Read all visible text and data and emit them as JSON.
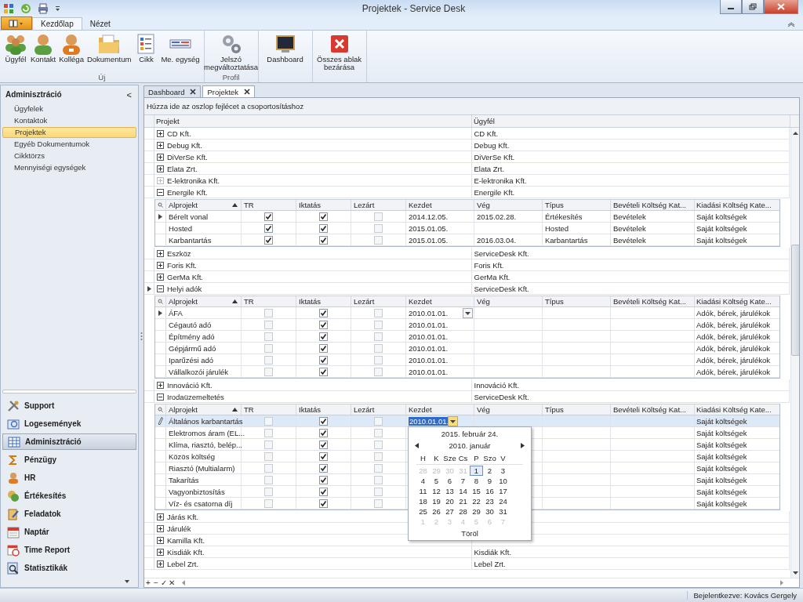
{
  "window": {
    "title": "Projektek - Service Desk"
  },
  "ribbon": {
    "tabs": [
      {
        "label": "Kezdőlap",
        "selected": true
      },
      {
        "label": "Nézet",
        "selected": false
      }
    ],
    "groups": [
      {
        "label": "Új",
        "buttons": [
          "Ügyfél",
          "Kontakt",
          "Kolléga",
          "Dokumentum",
          "Cikk",
          "Me. egység"
        ]
      },
      {
        "label": "Profil",
        "buttons": [
          "Jelszó megváltoztatása"
        ]
      },
      {
        "buttons": [
          "Dashboard"
        ]
      },
      {
        "buttons": [
          "Összes ablak bezárása"
        ]
      }
    ]
  },
  "sidebar": {
    "title": "Adminisztráció",
    "collapse": "<",
    "items": [
      {
        "label": "Ügyfelek",
        "selected": false
      },
      {
        "label": "Kontaktok",
        "selected": false
      },
      {
        "label": "Projektek",
        "selected": true
      },
      {
        "label": "Egyéb Dokumentumok",
        "selected": false
      },
      {
        "label": "Cikktörzs",
        "selected": false
      },
      {
        "label": "Mennyiségi egységek",
        "selected": false
      }
    ],
    "nav": [
      {
        "label": "Support",
        "selected": false
      },
      {
        "label": "Logesemények",
        "selected": false
      },
      {
        "label": "Adminisztráció",
        "selected": true
      },
      {
        "label": "Pénzügy",
        "selected": false
      },
      {
        "label": "HR",
        "selected": false
      },
      {
        "label": "Értékesítés",
        "selected": false
      },
      {
        "label": "Feladatok",
        "selected": false
      },
      {
        "label": "Naptár",
        "selected": false
      },
      {
        "label": "Time Report",
        "selected": false
      },
      {
        "label": "Statisztikák",
        "selected": false
      }
    ]
  },
  "doc_tabs": [
    {
      "label": "Dashboard",
      "selected": false
    },
    {
      "label": "Projektek",
      "selected": true
    }
  ],
  "grid": {
    "group_panel": "Húzza ide az oszlop fejlécet a csoportosításhoz",
    "columns": [
      "Projekt",
      "Ügyfél"
    ],
    "rows": [
      {
        "projekt": "CD Kft.",
        "ugyfel": "CD Kft.",
        "expanded": false,
        "disabled": false,
        "current": false
      },
      {
        "projekt": "Debug Kft.",
        "ugyfel": "Debug Kft.",
        "expanded": false,
        "disabled": false,
        "current": false
      },
      {
        "projekt": "DiVerSe Kft.",
        "ugyfel": "DiVerSe Kft.",
        "expanded": false,
        "disabled": false,
        "current": false
      },
      {
        "projekt": "Elata Zrt.",
        "ugyfel": "Elata Zrt.",
        "expanded": false,
        "disabled": false,
        "current": false
      },
      {
        "projekt": "E-lektronika Kft.",
        "ugyfel": "E-lektronika Kft.",
        "expanded": false,
        "disabled": true,
        "current": false
      },
      {
        "projekt": "Energile Kft.",
        "ugyfel": "Energile Kft.",
        "expanded": true,
        "disabled": false,
        "current": false,
        "subgrid": {
          "columns": [
            {
              "label": "Alprojekt",
              "sorted": true
            },
            {
              "label": "TR",
              "sorted": false
            },
            {
              "label": "Iktatás",
              "sorted": false
            },
            {
              "label": "Lezárt",
              "sorted": false
            },
            {
              "label": "Kezdet",
              "sorted": false
            },
            {
              "label": "Vég",
              "sorted": false
            },
            {
              "label": "Típus",
              "sorted": false
            },
            {
              "label": "Bevételi Költség Kat...",
              "sorted": false
            },
            {
              "label": "Kiadási Költség Kate...",
              "sorted": false
            }
          ],
          "rows": [
            {
              "current": true,
              "editing": false,
              "selected": false,
              "kezdet_dropdown": false,
              "alprojekt": "Bérelt vonal",
              "tr": true,
              "iktatas": true,
              "lezart": false,
              "kezdet": "2014.12.05.",
              "veg": "2015.02.28.",
              "tipus": "Értékesítés",
              "bevetel": "Bevételek",
              "kiadas": "Saját költségek"
            },
            {
              "current": false,
              "editing": false,
              "selected": false,
              "kezdet_dropdown": false,
              "alprojekt": "Hosted",
              "tr": true,
              "iktatas": true,
              "lezart": false,
              "kezdet": "2015.01.05.",
              "tipus": "Hosted",
              "bevetel": "Bevételek",
              "kiadas": "Saját költségek"
            },
            {
              "current": false,
              "editing": false,
              "selected": false,
              "kezdet_dropdown": false,
              "alprojekt": "Karbantartás",
              "tr": true,
              "iktatas": true,
              "lezart": false,
              "kezdet": "2015.01.05.",
              "veg": "2016.03.04.",
              "tipus": "Karbantartás",
              "bevetel": "Bevételek",
              "kiadas": "Saját költségek"
            }
          ]
        }
      },
      {
        "projekt": "Eszköz",
        "ugyfel": "ServiceDesk Kft.",
        "expanded": false,
        "disabled": false,
        "current": false
      },
      {
        "projekt": "Foris Kft.",
        "ugyfel": "Foris Kft.",
        "expanded": false,
        "disabled": false,
        "current": false
      },
      {
        "projekt": "GerMa Kft.",
        "ugyfel": "GerMa Kft.",
        "expanded": false,
        "disabled": false,
        "current": false
      },
      {
        "projekt": "Helyi adók",
        "ugyfel": "ServiceDesk Kft.",
        "expanded": true,
        "disabled": false,
        "current": true,
        "subgrid": {
          "columns": [
            {
              "label": "Alprojekt",
              "sorted": true
            },
            {
              "label": "TR",
              "sorted": false
            },
            {
              "label": "Iktatás",
              "sorted": false
            },
            {
              "label": "Lezárt",
              "sorted": false
            },
            {
              "label": "Kezdet",
              "sorted": false
            },
            {
              "label": "Vég",
              "sorted": false
            },
            {
              "label": "Típus",
              "sorted": false
            },
            {
              "label": "Bevételi Költség Kat...",
              "sorted": false
            },
            {
              "label": "Kiadási Költség Kate...",
              "sorted": false
            }
          ],
          "rows": [
            {
              "current": true,
              "editing": false,
              "selected": false,
              "kezdet_dropdown": true,
              "alprojekt": "ÁFA",
              "tr": false,
              "iktatas": true,
              "lezart": false,
              "kezdet": "2010.01.01.",
              "kiadas": "Adók, bérek, járulékok"
            },
            {
              "current": false,
              "editing": false,
              "selected": false,
              "kezdet_dropdown": false,
              "alprojekt": "Cégautó adó",
              "tr": false,
              "iktatas": true,
              "lezart": false,
              "kezdet": "2010.01.01.",
              "kiadas": "Adók, bérek, járulékok"
            },
            {
              "current": false,
              "editing": false,
              "selected": false,
              "kezdet_dropdown": false,
              "alprojekt": "Építmény adó",
              "tr": false,
              "iktatas": true,
              "lezart": false,
              "kezdet": "2010.01.01.",
              "kiadas": "Adók, bérek, járulékok"
            },
            {
              "current": false,
              "editing": false,
              "selected": false,
              "kezdet_dropdown": false,
              "alprojekt": "Gépjármű adó",
              "tr": false,
              "iktatas": true,
              "lezart": false,
              "kezdet": "2010.01.01.",
              "kiadas": "Adók, bérek, járulékok"
            },
            {
              "current": false,
              "editing": false,
              "selected": false,
              "kezdet_dropdown": false,
              "alprojekt": "Iparűzési adó",
              "tr": false,
              "iktatas": true,
              "lezart": false,
              "kezdet": "2010.01.01.",
              "kiadas": "Adók, bérek, járulékok"
            },
            {
              "current": false,
              "editing": false,
              "selected": false,
              "kezdet_dropdown": false,
              "alprojekt": "Vállalkozói járulék",
              "tr": false,
              "iktatas": true,
              "lezart": false,
              "kezdet": "2010.01.01.",
              "kiadas": "Adók, bérek, járulékok"
            }
          ]
        }
      },
      {
        "projekt": "Innováció Kft.",
        "ugyfel": "Innováció Kft.",
        "expanded": false,
        "disabled": false,
        "current": false
      },
      {
        "projekt": "Irodaüzemeltetés",
        "ugyfel": "ServiceDesk Kft.",
        "expanded": true,
        "disabled": false,
        "current": false,
        "subgrid": {
          "columns": [
            {
              "label": "Alprojekt",
              "sorted": true
            },
            {
              "label": "TR",
              "sorted": false
            },
            {
              "label": "Iktatás",
              "sorted": false
            },
            {
              "label": "Lezárt",
              "sorted": false
            },
            {
              "label": "Kezdet",
              "sorted": false
            },
            {
              "label": "Vég",
              "sorted": false
            },
            {
              "label": "Típus",
              "sorted": false
            },
            {
              "label": "Bevételi Költség Kat...",
              "sorted": false
            },
            {
              "label": "Kiadási Költség Kate...",
              "sorted": false
            }
          ],
          "rows": [
            {
              "current": false,
              "editing": true,
              "selected": true,
              "kezdet_dropdown": true,
              "alprojekt": "Általános karbantartás",
              "tr": false,
              "iktatas": true,
              "lezart": false,
              "kezdet": "2010.01.01.",
              "kiadas": "Saját költségek"
            },
            {
              "current": false,
              "editing": false,
              "selected": false,
              "kezdet_dropdown": false,
              "alprojekt": "Elektromos áram (EL...",
              "tr": false,
              "iktatas": true,
              "lezart": false,
              "kiadas": "Saját költségek"
            },
            {
              "current": false,
              "editing": false,
              "selected": false,
              "kezdet_dropdown": false,
              "alprojekt": "Klíma, riasztó, belép...",
              "tr": false,
              "iktatas": true,
              "lezart": false,
              "kiadas": "Saját költségek"
            },
            {
              "current": false,
              "editing": false,
              "selected": false,
              "kezdet_dropdown": false,
              "alprojekt": "Közös költség",
              "tr": false,
              "iktatas": true,
              "lezart": false,
              "kiadas": "Saját költségek"
            },
            {
              "current": false,
              "editing": false,
              "selected": false,
              "kezdet_dropdown": false,
              "alprojekt": "Riasztó (Multialarm)",
              "tr": false,
              "iktatas": true,
              "lezart": false,
              "kiadas": "Saját költségek"
            },
            {
              "current": false,
              "editing": false,
              "selected": false,
              "kezdet_dropdown": false,
              "alprojekt": "Takarítás",
              "tr": false,
              "iktatas": true,
              "lezart": false,
              "kiadas": "Saját költségek"
            },
            {
              "current": false,
              "editing": false,
              "selected": false,
              "kezdet_dropdown": false,
              "alprojekt": "Vagyonbiztosítás",
              "tr": false,
              "iktatas": true,
              "lezart": false,
              "kiadas": "Saját költségek"
            },
            {
              "current": false,
              "editing": false,
              "selected": false,
              "kezdet_dropdown": false,
              "alprojekt": "Víz- és csatorna díj",
              "tr": false,
              "iktatas": true,
              "lezart": false,
              "kiadas": "Saját költségek"
            }
          ]
        }
      },
      {
        "projekt": "Járás Kft.",
        "expanded": false,
        "disabled": false,
        "current": false
      },
      {
        "projekt": "Járulék",
        "expanded": false,
        "disabled": false,
        "current": false
      },
      {
        "projekt": "Kamilla Kft.",
        "expanded": false,
        "disabled": false,
        "current": false
      },
      {
        "projekt": "Kisdiák Kft.",
        "ugyfel": "Kisdiák Kft.",
        "expanded": false,
        "disabled": false,
        "current": false
      },
      {
        "projekt": "Lebel Zrt.",
        "ugyfel": "Lebel Zrt.",
        "expanded": false,
        "disabled": false,
        "current": false
      }
    ],
    "nav_buttons": [
      "+",
      "−",
      "✓",
      "✕"
    ]
  },
  "date_picker": {
    "today": "2015. február 24.",
    "month": "2010. január",
    "weekdays": [
      "H",
      "K",
      "Sze",
      "Cs",
      "P",
      "Szo",
      "V"
    ],
    "days": [
      {
        "d": "28",
        "muted": true,
        "selected": false
      },
      {
        "d": "29",
        "muted": true,
        "selected": false
      },
      {
        "d": "30",
        "muted": true,
        "selected": false
      },
      {
        "d": "31",
        "muted": true,
        "selected": false
      },
      {
        "d": "1",
        "muted": false,
        "selected": true
      },
      {
        "d": "2",
        "muted": false,
        "selected": false
      },
      {
        "d": "3",
        "muted": false,
        "selected": false
      },
      {
        "d": "4",
        "muted": false,
        "selected": false
      },
      {
        "d": "5",
        "muted": false,
        "selected": false
      },
      {
        "d": "6",
        "muted": false,
        "selected": false
      },
      {
        "d": "7",
        "muted": false,
        "selected": false
      },
      {
        "d": "8",
        "muted": false,
        "selected": false
      },
      {
        "d": "9",
        "muted": false,
        "selected": false
      },
      {
        "d": "10",
        "muted": false,
        "selected": false
      },
      {
        "d": "11",
        "muted": false,
        "selected": false
      },
      {
        "d": "12",
        "muted": false,
        "selected": false
      },
      {
        "d": "13",
        "muted": false,
        "selected": false
      },
      {
        "d": "14",
        "muted": false,
        "selected": false
      },
      {
        "d": "15",
        "muted": false,
        "selected": false
      },
      {
        "d": "16",
        "muted": false,
        "selected": false
      },
      {
        "d": "17",
        "muted": false,
        "selected": false
      },
      {
        "d": "18",
        "muted": false,
        "selected": false
      },
      {
        "d": "19",
        "muted": false,
        "selected": false
      },
      {
        "d": "20",
        "muted": false,
        "selected": false
      },
      {
        "d": "21",
        "muted": false,
        "selected": false
      },
      {
        "d": "22",
        "muted": false,
        "selected": false
      },
      {
        "d": "23",
        "muted": false,
        "selected": false
      },
      {
        "d": "24",
        "muted": false,
        "selected": false
      },
      {
        "d": "25",
        "muted": false,
        "selected": false
      },
      {
        "d": "26",
        "muted": false,
        "selected": false
      },
      {
        "d": "27",
        "muted": false,
        "selected": false
      },
      {
        "d": "28",
        "muted": false,
        "selected": false
      },
      {
        "d": "29",
        "muted": false,
        "selected": false
      },
      {
        "d": "30",
        "muted": false,
        "selected": false
      },
      {
        "d": "31",
        "muted": false,
        "selected": false
      },
      {
        "d": "1",
        "muted": true,
        "selected": false
      },
      {
        "d": "2",
        "muted": true,
        "selected": false
      },
      {
        "d": "3",
        "muted": true,
        "selected": false
      },
      {
        "d": "4",
        "muted": true,
        "selected": false
      },
      {
        "d": "5",
        "muted": true,
        "selected": false
      },
      {
        "d": "6",
        "muted": true,
        "selected": false
      },
      {
        "d": "7",
        "muted": true,
        "selected": false
      }
    ],
    "clear": "Töröl"
  },
  "status_bar": {
    "user": "Bejelentkezve: Kovács Gergely"
  }
}
